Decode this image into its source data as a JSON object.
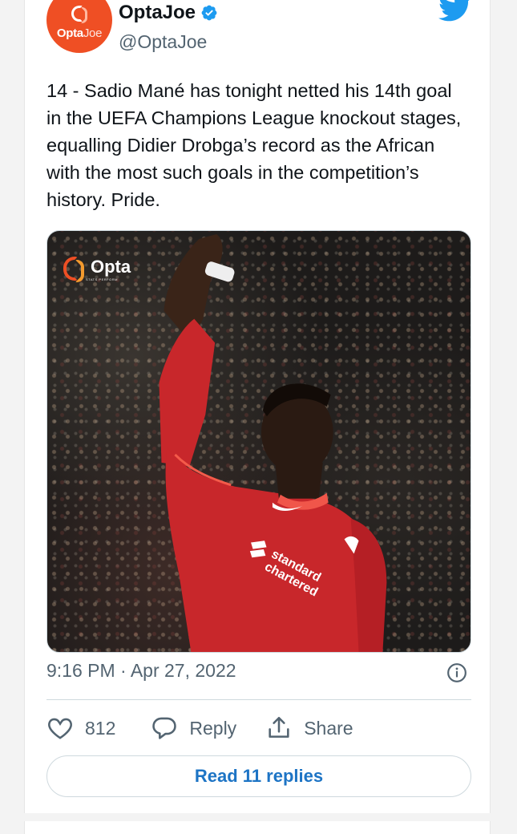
{
  "author": {
    "display_name": "OptaJoe",
    "handle": "@OptaJoe",
    "avatar_text_bold": "Opta",
    "avatar_text_light": "Joe",
    "verified": true
  },
  "tweet": {
    "text": "14 - Sadio Mané has tonight netted his 14th goal in the UEFA Champions League knockout stages, equalling Didier Drobga’s record as the African with the most such goals in the competition’s history. Pride.",
    "timestamp": "9:16 PM · Apr 27, 2022",
    "media": {
      "watermark": "Opta",
      "watermark_sub": "STATS PERFORM",
      "shirt_sponsor": "standard chartered"
    }
  },
  "actions": {
    "like_count": "812",
    "reply_label": "Reply",
    "share_label": "Share"
  },
  "read_replies_label": "Read 11 replies",
  "colors": {
    "twitter_blue": "#1d9bf0",
    "link_blue": "#1d74c5",
    "opta_orange": "#ef4f24",
    "muted_text": "#536471"
  },
  "icons": [
    "twitter-bird-icon",
    "verified-badge-icon",
    "info-icon",
    "heart-icon",
    "reply-bubble-icon",
    "share-icon"
  ]
}
